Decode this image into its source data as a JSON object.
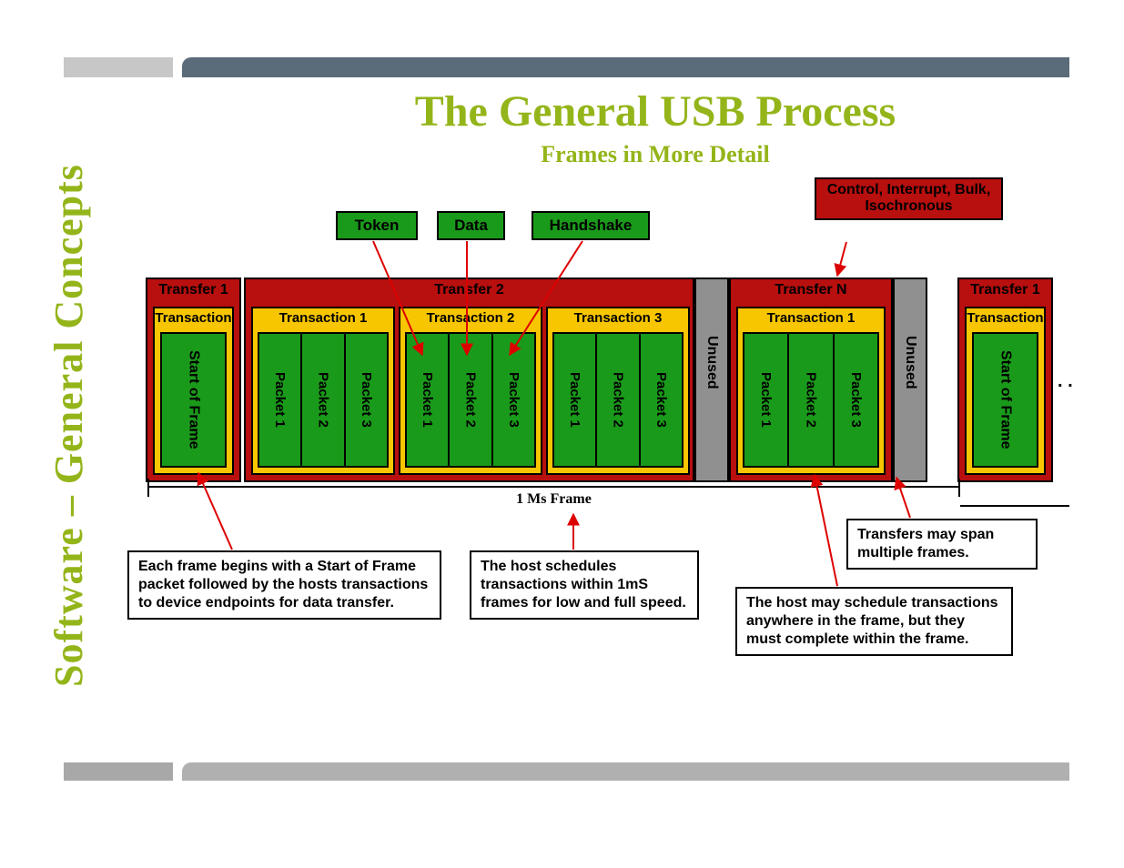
{
  "sidebar_label": "Software – General Concepts",
  "title": "The General USB Process",
  "subtitle": "Frames in More Detail",
  "legend": {
    "token": "Token",
    "data": "Data",
    "handshake": "Handshake",
    "red": "Control, Interrupt, Bulk, Isochronous"
  },
  "transfers": {
    "t1": "Transfer 1",
    "t2": "Transfer 2",
    "tn": "Transfer N",
    "t1b": "Transfer 1"
  },
  "tx": {
    "one": "Transaction 1",
    "two": "Transaction 2",
    "three": "Transaction 3",
    "plain": "Transaction"
  },
  "pk": {
    "p1": "Packet 1",
    "p2": "Packet 2",
    "p3": "Packet 3"
  },
  "sof": "Start of Frame",
  "unused": "Unused",
  "frame_label": "1 Ms Frame",
  "callouts": {
    "c1": "Each frame begins with a Start of Frame packet followed by the hosts transactions to device endpoints for data transfer.",
    "c2": "The host schedules transactions within 1mS frames for low and full speed.",
    "c3": "Transfers may span multiple frames.",
    "c4": "The host may schedule transactions anywhere in the frame, but they must complete within the frame."
  },
  "dots": ". ."
}
